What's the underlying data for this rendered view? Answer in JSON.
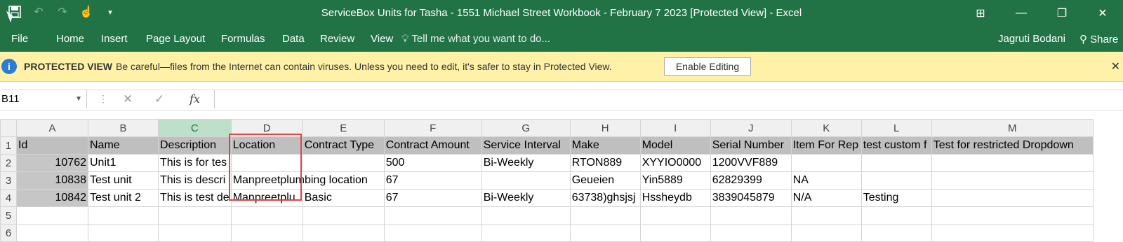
{
  "window": {
    "title": "ServiceBox Units for Tasha - 1551 Michael Street Workbook - February 7 2023  [Protected View] - Excel",
    "controls": [
      "⊞",
      "—",
      "❐",
      "✕"
    ]
  },
  "qat": {
    "icons": [
      "save-icon",
      "undo-icon",
      "redo-icon",
      "touch-mode-icon",
      "customize-icon"
    ]
  },
  "ribbon": {
    "tabs": [
      "File",
      "Home",
      "Insert",
      "Page Layout",
      "Formulas",
      "Data",
      "Review",
      "View"
    ],
    "tell_me": "Tell me what you want to do...",
    "user": "Jagruti Bodani",
    "share": "Share"
  },
  "protected_view": {
    "label": "PROTECTED VIEW",
    "message": "Be careful—files from the Internet can contain viruses. Unless you need to edit, it's safer to stay in Protected View.",
    "button": "Enable Editing"
  },
  "formula_bar": {
    "name_box": "B11",
    "value": ""
  },
  "sheet": {
    "columns": [
      "A",
      "B",
      "C",
      "D",
      "E",
      "F",
      "G",
      "H",
      "I",
      "J",
      "K",
      "L",
      "M"
    ],
    "rows": [
      [
        "Id",
        "Name",
        "Description",
        "Location",
        "Contract Type",
        "Contract Amount",
        "Service Interval",
        "Make",
        "Model",
        "Serial Number",
        "Item For Rep",
        "test custom f",
        "Test for restricted Dropdown"
      ],
      [
        "10762",
        "Unit1",
        "This is for tes",
        "",
        "",
        "500",
        "Bi-Weekly",
        "RTON889",
        "XYYIO0000",
        "1200VVF889",
        "",
        "",
        ""
      ],
      [
        "10838",
        "Test unit",
        "This is descri",
        "Manpreetplumbing location",
        "",
        "67",
        "",
        "Geueien",
        "Yin5889",
        "62829399",
        "NA",
        "",
        ""
      ],
      [
        "10842",
        "Test unit 2",
        "This is test de",
        "Manpreetplu",
        "Basic",
        "67",
        "Bi-Weekly",
        "63738)ghsjsj",
        "Hssheydb",
        "3839045879",
        "N/A",
        "Testing",
        ""
      ],
      [
        "",
        "",
        "",
        "",
        "",
        "",
        "",
        "",
        "",
        "",
        "",
        "",
        ""
      ],
      [
        "",
        "",
        "",
        "",
        "",
        "",
        "",
        "",
        "",
        "",
        "",
        "",
        ""
      ]
    ],
    "row_numbers": [
      "1",
      "2",
      "3",
      "4",
      "5",
      "6"
    ]
  },
  "colors": {
    "excel_green": "#217346",
    "warning_bar": "#fff1a8",
    "highlight_box": "#e04444"
  }
}
